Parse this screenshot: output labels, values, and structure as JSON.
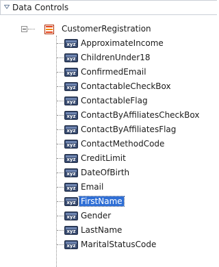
{
  "panel": {
    "title": "Data Controls",
    "root": {
      "label": "CustomerRegistration",
      "icon": "collection-icon"
    },
    "attribute_icon": "attribute-icon",
    "attributes": [
      "ApproximateIncome",
      "ChildrenUnder18",
      "ConfirmedEmail",
      "ContactableCheckBox",
      "ContactableFlag",
      "ContactByAffiliatesCheckBox",
      "ContactByAffiliatesFlag",
      "ContactMethodCode",
      "CreditLimit",
      "DateOfBirth",
      "Email",
      "FirstName",
      "Gender",
      "LastName",
      "MaritalStatusCode"
    ],
    "selected": "FirstName"
  }
}
